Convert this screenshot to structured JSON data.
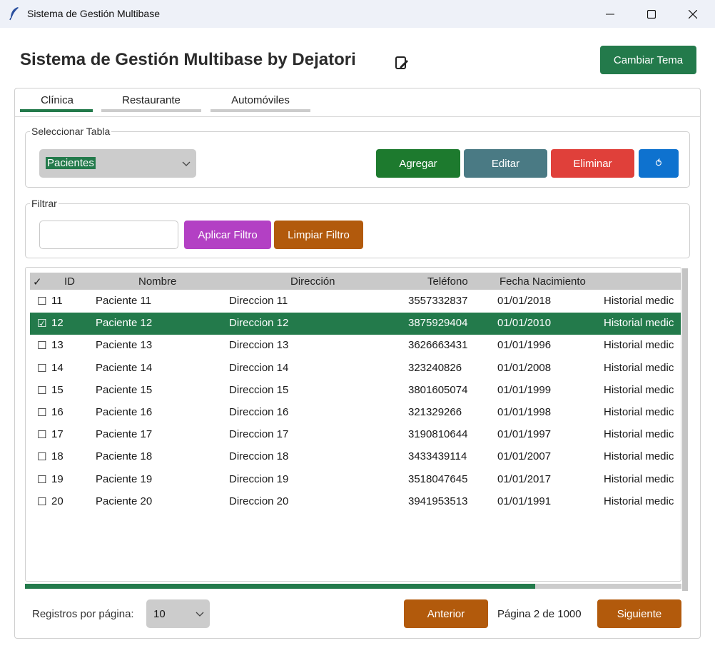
{
  "window": {
    "title": "Sistema de Gestión Multibase"
  },
  "header": {
    "title": "Sistema de Gestión Multibase by Dejatori",
    "theme_button": "Cambiar Tema"
  },
  "tabs": [
    {
      "label": "Clínica",
      "active": true
    },
    {
      "label": "Restaurante",
      "active": false
    },
    {
      "label": "Automóviles",
      "active": false
    }
  ],
  "table_select": {
    "legend": "Seleccionar Tabla",
    "selected": "Pacientes",
    "add_label": "Agregar",
    "edit_label": "Editar",
    "delete_label": "Eliminar",
    "refresh_label": "⥀"
  },
  "filter": {
    "legend": "Filtrar",
    "value": "",
    "apply_label": "Aplicar Filtro",
    "clear_label": "Limpiar Filtro"
  },
  "grid": {
    "columns": [
      "✓",
      "ID",
      "Nombre",
      "Dirección",
      "Teléfono",
      "Fecha Nacimiento"
    ],
    "rows": [
      {
        "check": "☐",
        "id": "11",
        "nombre": "Paciente 11",
        "direccion": "Direccion 11",
        "telefono": "3557332837",
        "fecha": "01/01/2018",
        "extra": "Historial medic"
      },
      {
        "check": "☑",
        "id": "12",
        "nombre": "Paciente 12",
        "direccion": "Direccion 12",
        "telefono": "3875929404",
        "fecha": "01/01/2010",
        "extra": "Historial medic",
        "selected": true
      },
      {
        "check": "☐",
        "id": "13",
        "nombre": "Paciente 13",
        "direccion": "Direccion 13",
        "telefono": "3626663431",
        "fecha": "01/01/1996",
        "extra": "Historial medic"
      },
      {
        "check": "☐",
        "id": "14",
        "nombre": "Paciente 14",
        "direccion": "Direccion 14",
        "telefono": "323240826",
        "fecha": "01/01/2008",
        "extra": "Historial medic"
      },
      {
        "check": "☐",
        "id": "15",
        "nombre": "Paciente 15",
        "direccion": "Direccion 15",
        "telefono": "3801605074",
        "fecha": "01/01/1999",
        "extra": "Historial medic"
      },
      {
        "check": "☐",
        "id": "16",
        "nombre": "Paciente 16",
        "direccion": "Direccion 16",
        "telefono": "321329266",
        "fecha": "01/01/1998",
        "extra": "Historial medic"
      },
      {
        "check": "☐",
        "id": "17",
        "nombre": "Paciente 17",
        "direccion": "Direccion 17",
        "telefono": "3190810644",
        "fecha": "01/01/1997",
        "extra": "Historial medic"
      },
      {
        "check": "☐",
        "id": "18",
        "nombre": "Paciente 18",
        "direccion": "Direccion 18",
        "telefono": "3433439114",
        "fecha": "01/01/2007",
        "extra": "Historial medic"
      },
      {
        "check": "☐",
        "id": "19",
        "nombre": "Paciente 19",
        "direccion": "Direccion 19",
        "telefono": "3518047645",
        "fecha": "01/01/2017",
        "extra": "Historial medic"
      },
      {
        "check": "☐",
        "id": "20",
        "nombre": "Paciente 20",
        "direccion": "Direccion 20",
        "telefono": "3941953513",
        "fecha": "01/01/1991",
        "extra": "Historial medic"
      }
    ]
  },
  "pagination": {
    "rpp_label": "Registros por página:",
    "rpp_value": "10",
    "prev_label": "Anterior",
    "page_info": "Página 2 de 1000",
    "next_label": "Siguiente"
  },
  "colors": {
    "accent_green": "#237a4b",
    "add": "#1d7a2e",
    "edit": "#4a7a84",
    "delete": "#e0403a",
    "refresh": "#0e72cf",
    "apply": "#b340c4",
    "orange": "#b25a0c"
  },
  "icons": {
    "app": "feather-icon",
    "title_edit": "edit-document-icon",
    "refresh": "refresh-icon"
  }
}
